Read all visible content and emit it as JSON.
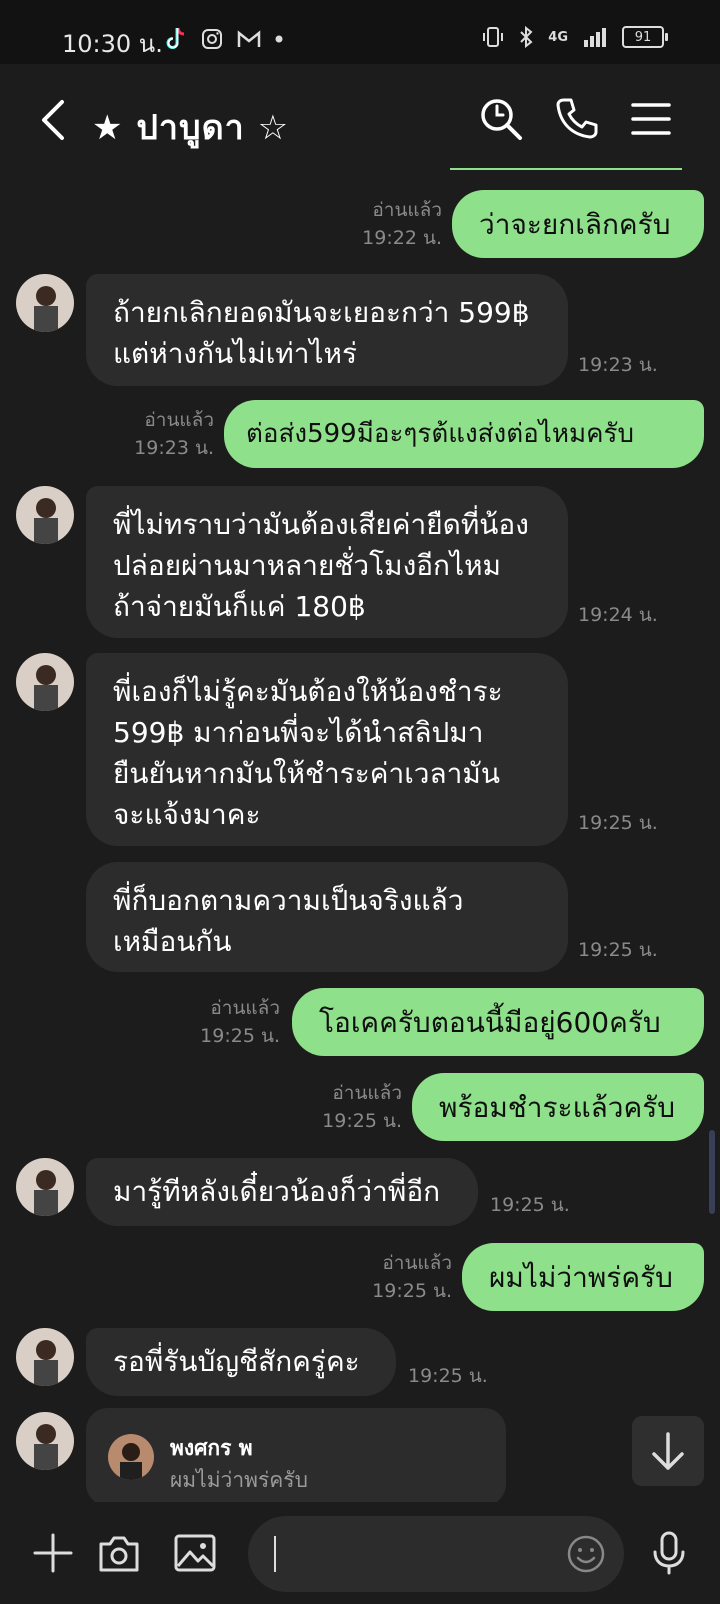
{
  "status_bar": {
    "time": "10:30 น.",
    "battery": "91",
    "network": "4G"
  },
  "header": {
    "title": "★ ปาบูดา ☆"
  },
  "messages": [
    {
      "dir": "out",
      "text": "ว่าจะยกเลิกครับ",
      "read": "อ่านแล้ว",
      "time": "19:22 น."
    },
    {
      "dir": "in",
      "text": "ถ้ายกเลิกยอดมันจะเยอะกว่า 599฿ แต่ห่างกันไม่เท่าไหร่",
      "time": "19:23 น."
    },
    {
      "dir": "out",
      "text": "ต่อส่ง599มีอะๆรต้แงส่งต่อไหมครับ",
      "read": "อ่านแล้ว",
      "time": "19:23 น."
    },
    {
      "dir": "in",
      "text": "พี่ไม่ทราบว่ามันต้องเสียค่ายืดที่น้องปล่อยผ่านมาหลายชั่วโมงอีกไหม ถ้าจ่ายมันก็แค่ 180฿",
      "time": "19:24 น."
    },
    {
      "dir": "in",
      "text": "พี่เองก็ไม่รู้คะมันต้องให้น้องชำระ 599฿ มาก่อนพี่จะได้นำสลิปมายืนยันหากมันให้ชำระค่าเวลามันจะแจ้งมาคะ",
      "time": "19:25 น."
    },
    {
      "dir": "in",
      "text": "พี่ก็บอกตามความเป็นจริงแล้วเหมือนกัน",
      "time": "19:25 น."
    },
    {
      "dir": "out",
      "text": "โอเคครับตอนนี้มีอยู่600ครับ",
      "read": "อ่านแล้ว",
      "time": "19:25 น."
    },
    {
      "dir": "out",
      "text": "พร้อมชำระแล้วครับ",
      "read": "อ่านแล้ว",
      "time": "19:25 น."
    },
    {
      "dir": "in",
      "text": "มารู้ทีหลังเดี๋ยวน้องก็ว่าพี่อีก",
      "time": "19:25 น."
    },
    {
      "dir": "out",
      "text": "ผมไม่ว่าพร่ครับ",
      "read": "อ่านแล้ว",
      "time": "19:25 น."
    },
    {
      "dir": "in",
      "text": "รอพี่รันบัญชีสักครู่คะ",
      "time": "19:25 น."
    }
  ],
  "reply_card": {
    "name": "พงศกร พ",
    "text": "ผมไม่ว่าพร่ครับ"
  },
  "colors": {
    "outgoing_bubble": "#8fe08a",
    "incoming_bubble": "#2c2c2c",
    "background": "#1c1c1c"
  }
}
